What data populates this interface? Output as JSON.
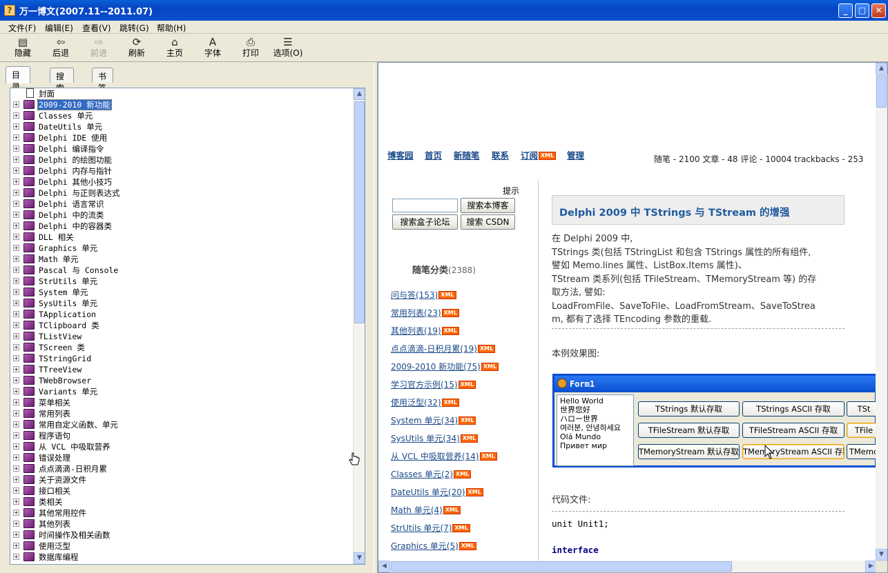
{
  "window": {
    "title": "万一博文(2007.11--2011.07)",
    "icon": "help-book-icon"
  },
  "menu": [
    "文件(F)",
    "编辑(E)",
    "查看(V)",
    "跳转(G)",
    "帮助(H)"
  ],
  "toolbar": [
    {
      "label": "隐藏",
      "icon": "hide-icon",
      "enabled": true
    },
    {
      "label": "后退",
      "icon": "back-arrow-icon",
      "enabled": true
    },
    {
      "label": "前进",
      "icon": "forward-arrow-icon",
      "enabled": false
    },
    {
      "label": "刷新",
      "icon": "refresh-icon",
      "enabled": true
    },
    {
      "label": "主页",
      "icon": "home-icon",
      "enabled": true
    },
    {
      "label": "字体",
      "icon": "font-icon",
      "enabled": true
    },
    {
      "label": "打印",
      "icon": "print-icon",
      "enabled": true
    },
    {
      "label": "选项(O)",
      "icon": "options-icon",
      "enabled": true
    }
  ],
  "tabs": [
    "目录(C)",
    "搜索(S)",
    "书签(I)"
  ],
  "tree": [
    {
      "label": "封面",
      "type": "page"
    },
    {
      "label": "2009-2010 新功能",
      "type": "book",
      "selected": true
    },
    {
      "label": "Classes 单元",
      "type": "book"
    },
    {
      "label": "DateUtils 单元",
      "type": "book"
    },
    {
      "label": "Delphi IDE 使用",
      "type": "book"
    },
    {
      "label": "Delphi 编译指令",
      "type": "book"
    },
    {
      "label": "Delphi 的绘图功能",
      "type": "book"
    },
    {
      "label": "Delphi 内存与指针",
      "type": "book"
    },
    {
      "label": "Delphi 其他小技巧",
      "type": "book"
    },
    {
      "label": "Delphi 与正则表达式",
      "type": "book"
    },
    {
      "label": "Delphi 语言常识",
      "type": "book"
    },
    {
      "label": "Delphi 中的流类",
      "type": "book"
    },
    {
      "label": "Delphi 中的容器类",
      "type": "book"
    },
    {
      "label": "DLL 相关",
      "type": "book"
    },
    {
      "label": "Graphics 单元",
      "type": "book"
    },
    {
      "label": "Math 单元",
      "type": "book"
    },
    {
      "label": "Pascal 与 Console",
      "type": "book"
    },
    {
      "label": "StrUtils 单元",
      "type": "book"
    },
    {
      "label": "System 单元",
      "type": "book"
    },
    {
      "label": "SysUtils 单元",
      "type": "book"
    },
    {
      "label": "TApplication",
      "type": "book"
    },
    {
      "label": "TClipboard 类",
      "type": "book"
    },
    {
      "label": "TListView",
      "type": "book"
    },
    {
      "label": "TScreen 类",
      "type": "book"
    },
    {
      "label": "TStringGrid",
      "type": "book"
    },
    {
      "label": "TTreeView",
      "type": "book"
    },
    {
      "label": "TWebBrowser",
      "type": "book"
    },
    {
      "label": "Variants 单元",
      "type": "book"
    },
    {
      "label": "菜单相关",
      "type": "book"
    },
    {
      "label": "常用列表",
      "type": "book"
    },
    {
      "label": "常用自定义函数、单元",
      "type": "book"
    },
    {
      "label": "程序语句",
      "type": "book"
    },
    {
      "label": "从 VCL 中吸取营养",
      "type": "book"
    },
    {
      "label": "错误处理",
      "type": "book"
    },
    {
      "label": "点点滴滴-日积月累",
      "type": "book"
    },
    {
      "label": "关于资源文件",
      "type": "book"
    },
    {
      "label": "接口相关",
      "type": "book"
    },
    {
      "label": "类相关",
      "type": "book"
    },
    {
      "label": "其他常用控件",
      "type": "book"
    },
    {
      "label": "其他列表",
      "type": "book"
    },
    {
      "label": "时间操作及相关函数",
      "type": "book"
    },
    {
      "label": "使用泛型",
      "type": "book"
    },
    {
      "label": "数据库编程",
      "type": "book"
    }
  ],
  "blog": {
    "nav": [
      "博客园",
      "首页",
      "新随笔",
      "联系",
      "订阅",
      "管理"
    ],
    "xml_badge": "XML",
    "stats": "随笔 - 2100  文章 - 48 评论 - 10004 trackbacks - 253",
    "sidebar": {
      "tip": "提示",
      "search_value": "",
      "btn_search_blog": "搜索本博客",
      "btn_search_box": "搜索盒子论坛",
      "btn_search_csdn": "搜索 CSDN",
      "category_title": "随笔分类",
      "category_count": "(2388)",
      "categories": [
        "问与答(153)",
        "常用列表(23)",
        "其他列表(19)",
        "点点滴滴-日积月累(19)",
        "2009-2010 新功能(75)",
        "学习官方示例(15)",
        "使用泛型(32)",
        "System 单元(34)",
        "SysUtils 单元(34)",
        "从 VCL 中吸取营养(14)",
        "Classes 单元(2)",
        "DateUtils 单元(20)",
        "Math 单元(4)",
        "StrUtils 单元(7)",
        "Graphics 单元(5)"
      ]
    },
    "article": {
      "title": "Delphi 2009 中 TStrings 与 TStream 的增强",
      "lines": [
        "在 Delphi 2009 中,",
        "TStrings 类(包括 TStringList 和包含 TStrings 属性的所有组件,",
        "譬如 Memo.lines 属性、ListBox.Items 属性)、",
        "TStream 类系列(包括 TFileStream、TMemoryStream 等) 的存",
        "取方法, 譬如:",
        "LoadFromFile、SaveToFile、LoadFromStream、SaveToStrea",
        "m, 都有了选择 TEncoding 参数的重载."
      ],
      "example_label": "本例效果图:",
      "code_label": "代码文件:",
      "code": [
        "unit Unit1;",
        "interface"
      ],
      "form": {
        "title": "Form1",
        "memo": [
          "Hello World",
          "世界您好",
          "ハロー世界",
          "여러분, 안녕하세요",
          "Olá Mundo",
          "Привет мир"
        ],
        "buttons": [
          [
            "TStrings 默认存取",
            "TStrings ASCII 存取",
            "TSt"
          ],
          [
            "TFileStream 默认存取",
            "TFileStream ASCII 存取",
            "TFile"
          ],
          [
            "TMemoryStream 默认存取",
            "TMemoryStream ASCII 存取",
            "TMemo"
          ]
        ]
      }
    }
  }
}
